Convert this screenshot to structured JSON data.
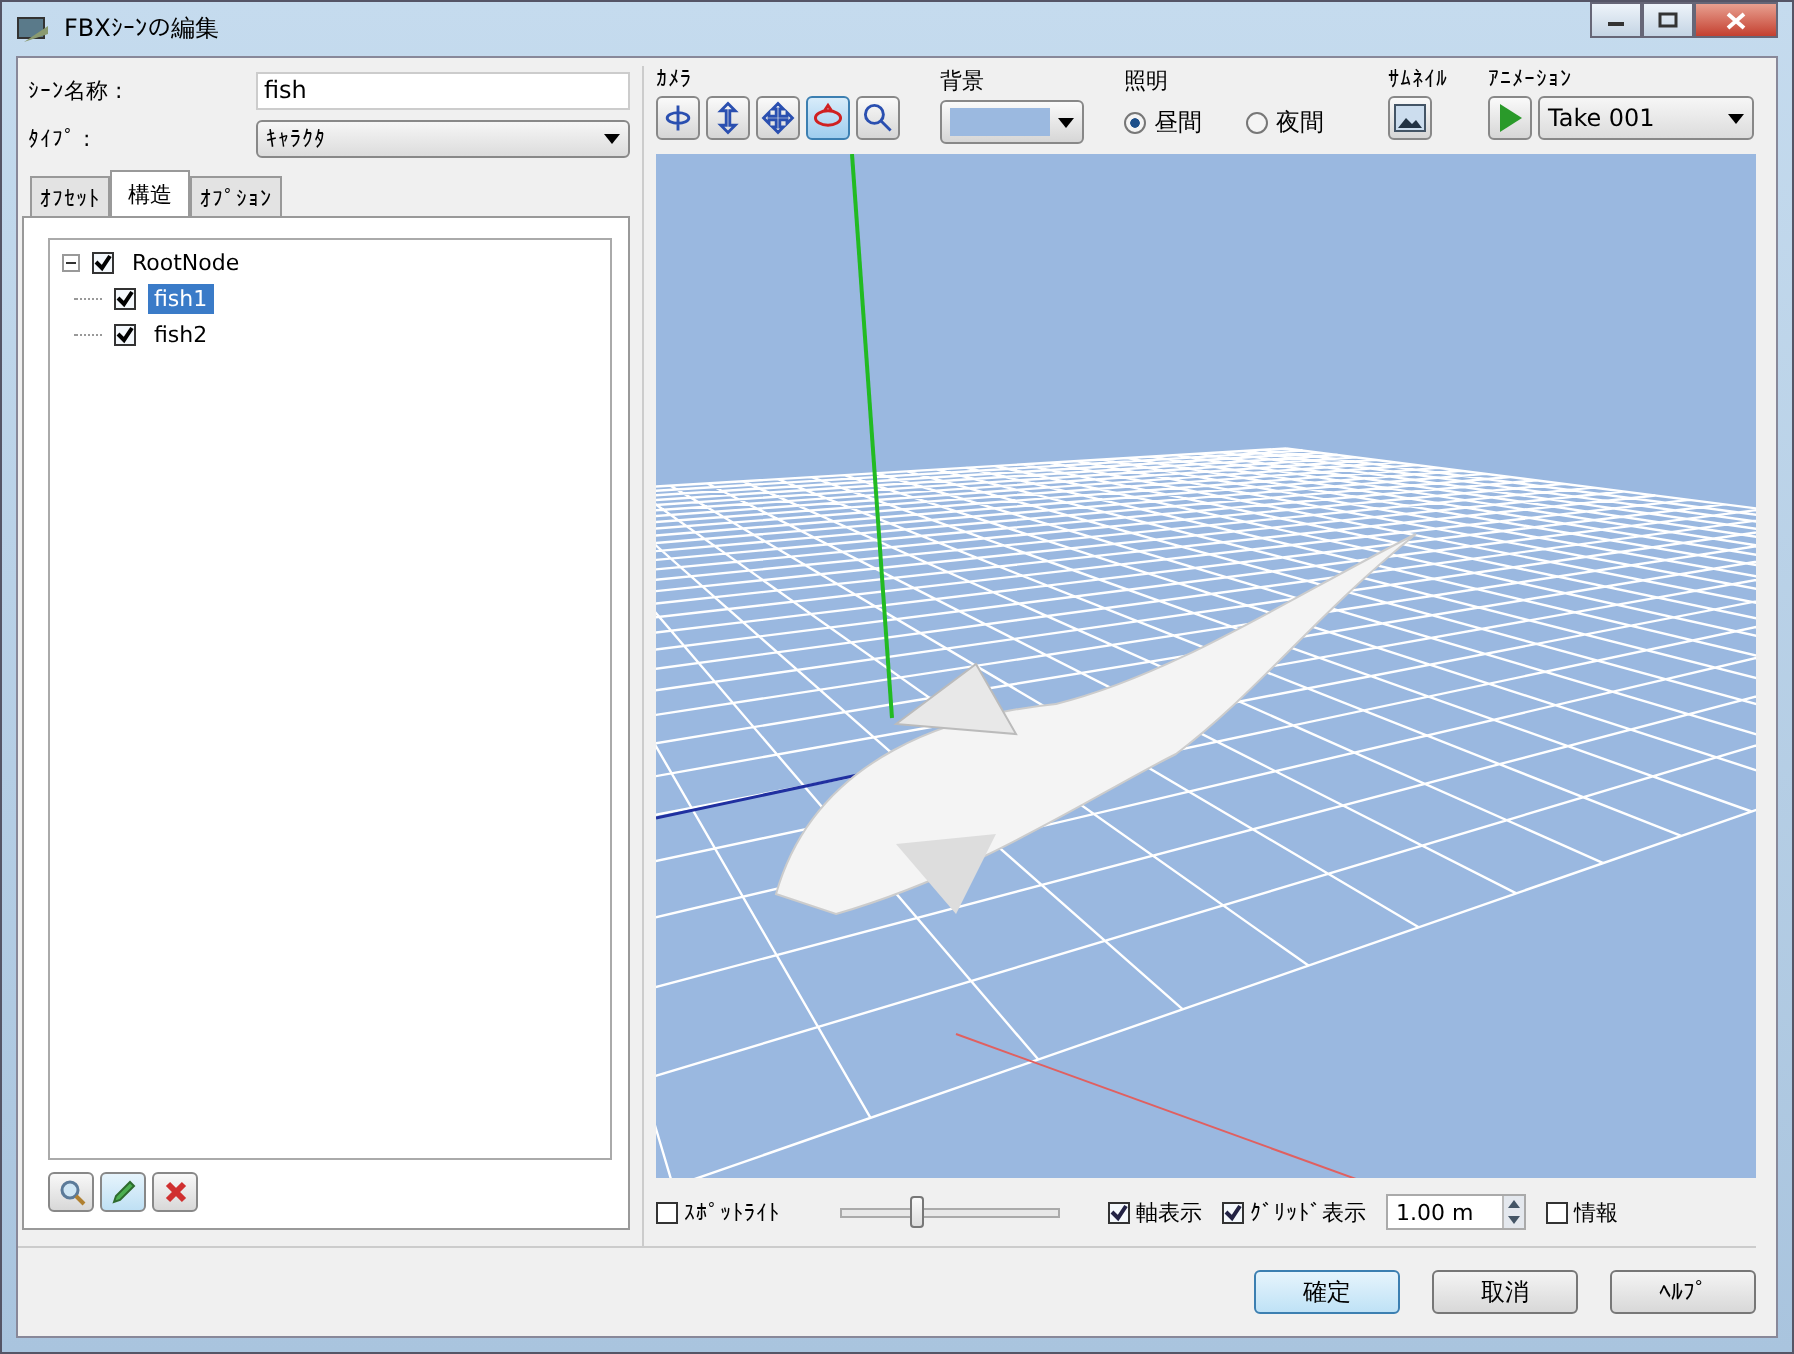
{
  "window": {
    "title": "FBXｼｰﾝの編集"
  },
  "scene_name": {
    "label": "ｼｰﾝ名称 :",
    "value": "fish"
  },
  "type": {
    "label": "ﾀｲﾌﾟ :",
    "value": "ｷｬﾗｸﾀ"
  },
  "tabs": [
    {
      "label": "ｵﾌｾｯﾄ",
      "selected": false
    },
    {
      "label": "構造",
      "selected": true
    },
    {
      "label": "ｵﾌﾟｼｮﾝ",
      "selected": false
    }
  ],
  "tree": [
    {
      "label": "RootNode",
      "checked": true,
      "expanded": true,
      "selected": false,
      "children": [
        {
          "label": "fish1",
          "checked": true,
          "selected": true
        },
        {
          "label": "fish2",
          "checked": true,
          "selected": false
        }
      ]
    }
  ],
  "toolbar": {
    "camera_label": "ｶﾒﾗ",
    "camera_tools": [
      {
        "kind": "orbit",
        "selected": false
      },
      {
        "kind": "updown",
        "selected": false
      },
      {
        "kind": "pan",
        "selected": false
      },
      {
        "kind": "rotate",
        "selected": true
      },
      {
        "kind": "zoom",
        "selected": false
      }
    ],
    "background_label": "背景",
    "lighting_label": "照明",
    "lighting": [
      {
        "label": "昼間",
        "selected": true
      },
      {
        "label": "夜間",
        "selected": false
      }
    ],
    "thumbnail_label": "ｻﾑﾈｲﾙ",
    "animation_label": "ｱﾆﾒｰｼｮﾝ",
    "animation": "Take 001"
  },
  "bottom": {
    "spotlight": {
      "label": "ｽﾎﾟｯﾄﾗｲﾄ",
      "checked": false
    },
    "light_slider": {
      "level": 0.35
    },
    "axis": {
      "label": "軸表示",
      "checked": true
    },
    "grid": {
      "label": "ｸﾞﾘｯﾄﾞ表示",
      "checked": true
    },
    "grid_size": "1.00 m",
    "info": {
      "label": "情報",
      "checked": false
    }
  },
  "buttons": [
    "確定",
    "取消",
    "ﾍﾙﾌﾟ"
  ]
}
